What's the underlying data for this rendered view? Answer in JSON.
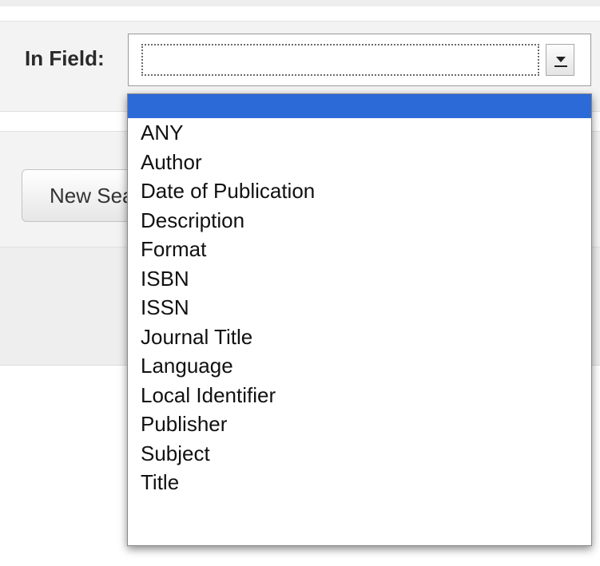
{
  "field": {
    "label": "In Field:",
    "selected_value": ""
  },
  "new_search_button": {
    "label": "New Search"
  },
  "dropdown": {
    "options": [
      "",
      "ANY",
      "Author",
      "Date of Publication",
      "Description",
      "Format",
      "ISBN",
      "ISSN",
      "Journal Title",
      "Language",
      "Local Identifier",
      "Publisher",
      "Subject",
      "Title"
    ],
    "selected_index": 0
  },
  "colors": {
    "selection_highlight": "#2c6ad8",
    "panel_background": "#f3f3f3"
  },
  "icons": {
    "select_arrow": "chevron-down-icon"
  }
}
